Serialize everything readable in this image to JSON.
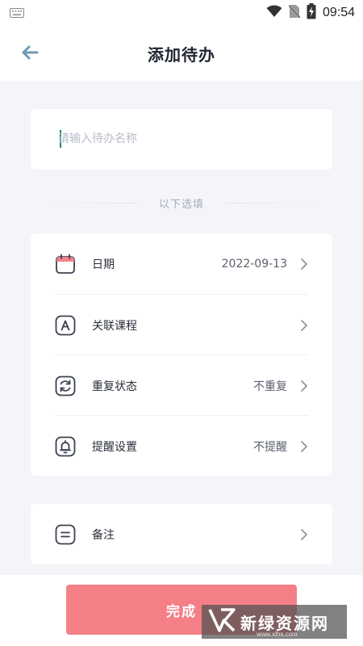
{
  "status_bar": {
    "time": "09:54",
    "icons": [
      "keyboard-icon",
      "wifi-icon",
      "no-sim-icon",
      "battery-charging-icon"
    ]
  },
  "header": {
    "title": "添加待办",
    "back_icon": "arrow-left-icon"
  },
  "name_field": {
    "placeholder": "请输入待办名称",
    "value": ""
  },
  "divider": {
    "label": "以下选填"
  },
  "options": [
    {
      "icon": "calendar-icon",
      "label": "日期",
      "value": "2022-09-13"
    },
    {
      "icon": "course-a-icon",
      "label": "关联课程",
      "value": ""
    },
    {
      "icon": "repeat-icon",
      "label": "重复状态",
      "value": "不重复"
    },
    {
      "icon": "bell-icon",
      "label": "提醒设置",
      "value": "不提醒"
    }
  ],
  "notes": {
    "icon": "notes-icon",
    "label": "备注"
  },
  "done_button": {
    "label": "完成"
  },
  "watermark": {
    "text": "新绿资源网",
    "url": "www.xlhs.com"
  },
  "colors": {
    "accent_button": "#f57f86",
    "icon_stroke": "#3c4250",
    "back_arrow": "#6b9bb0",
    "calendar_top": "#f0838a",
    "caret": "#1a8a7a",
    "background": "#f4f5f9"
  }
}
